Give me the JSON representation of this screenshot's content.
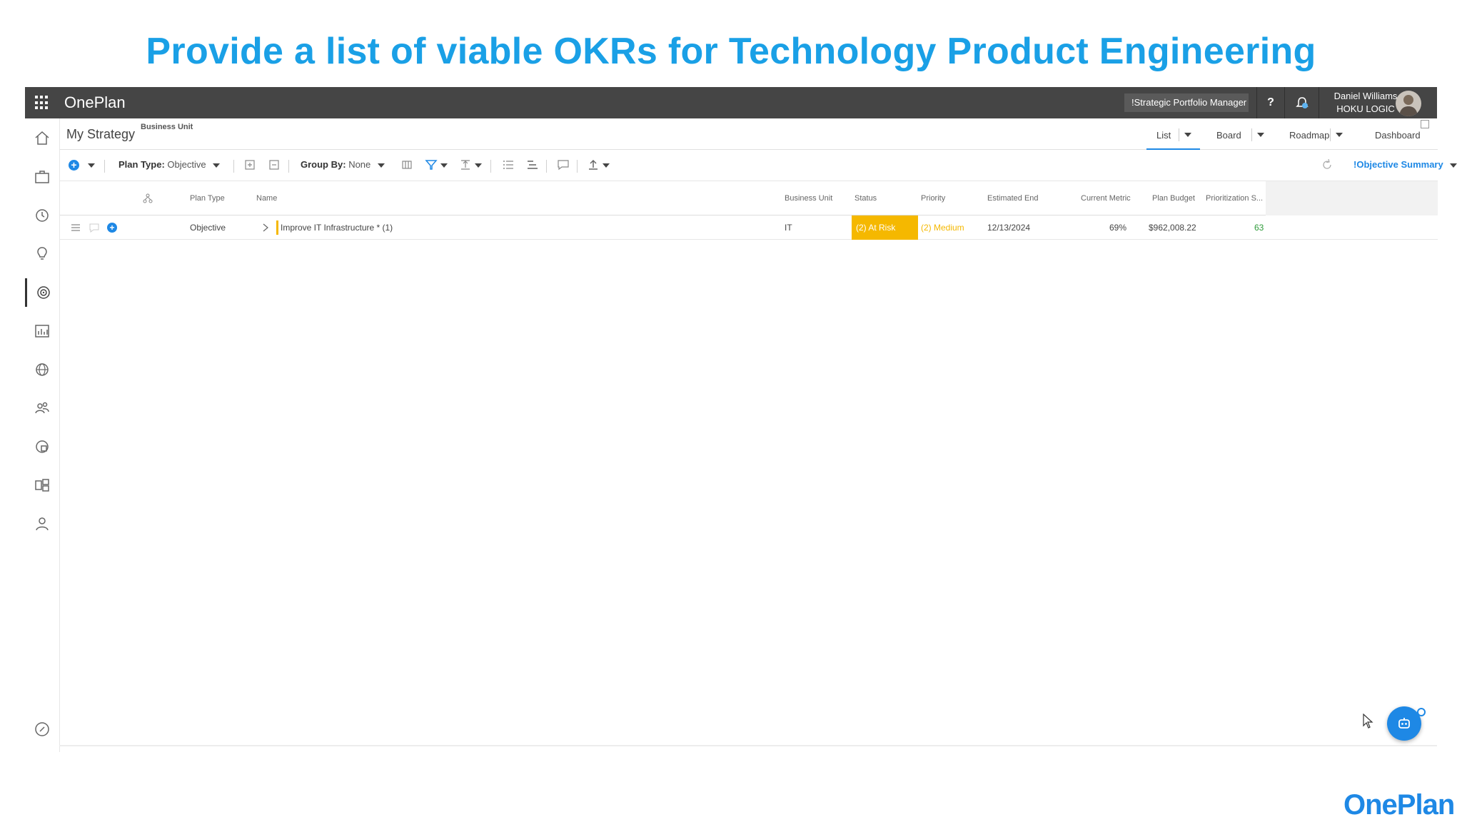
{
  "slide": {
    "title": "Provide a list of viable OKRs for Technology Product Engineering"
  },
  "topbar": {
    "app_name": "OnePlan",
    "workspace": "!Strategic Portfolio Manager",
    "help": "?",
    "user_name": "Daniel Williams",
    "user_org": "HOKU LOGIC"
  },
  "viewbar": {
    "page_title": "My Strategy",
    "breadcrumb_label": "Business Unit",
    "tabs": [
      {
        "label": "List"
      },
      {
        "label": "Board"
      },
      {
        "label": "Roadmap"
      },
      {
        "label": "Dashboard"
      }
    ]
  },
  "toolbar": {
    "plan_type_label": "Plan Type:",
    "plan_type_value": "Objective",
    "group_by_label": "Group By:",
    "group_by_value": "None",
    "view_selector": "!Objective Summary"
  },
  "grid": {
    "columns": [
      "Plan Type",
      "Name",
      "Business Unit",
      "Status",
      "Priority",
      "Estimated End",
      "Current Metric",
      "Plan Budget",
      "Prioritization S..."
    ],
    "rows": [
      {
        "plan_type": "Objective",
        "name": "Improve IT Infrastructure * (1)",
        "business_unit": "IT",
        "status": "(2) At Risk",
        "priority": "(2) Medium",
        "estimated_end": "12/13/2024",
        "current_metric": "69%",
        "plan_budget": "$962,008.22",
        "prioritization_score": "63"
      }
    ]
  },
  "colors": {
    "accent": "#1e88e5",
    "title": "#1aa0e6",
    "at_risk": "#f5b800",
    "topbar": "#454545",
    "score": "#2e9b3a"
  },
  "footer": {
    "logo": "OnePlan"
  }
}
